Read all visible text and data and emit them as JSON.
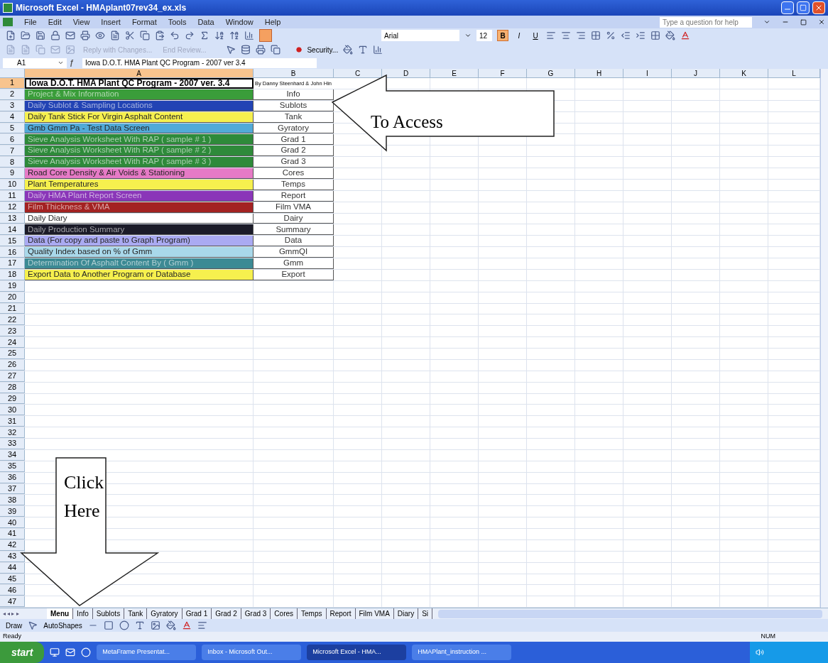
{
  "window": {
    "title": "Microsoft Excel - HMAplant07rev34_ex.xls"
  },
  "menu": [
    "File",
    "Edit",
    "View",
    "Insert",
    "Format",
    "Tools",
    "Data",
    "Window",
    "Help"
  ],
  "help_field": {
    "placeholder": "Type a question for help"
  },
  "formatting": {
    "font": "Arial",
    "size": "12",
    "styles": [
      {
        "label": "B",
        "on": true
      },
      {
        "label": "I",
        "on": false
      },
      {
        "label": "U",
        "on": false
      }
    ]
  },
  "review_toolbar": [
    {
      "label": "Reply with Changes...",
      "disabled": true
    },
    {
      "label": "End Review...",
      "disabled": true
    }
  ],
  "security_button": "Security...",
  "formula_bar": {
    "cell": "A1",
    "function_symbol": "ƒ",
    "formula": "Iowa D.O.T. HMA Plant QC Program - 2007 ver  3.4"
  },
  "columns": [
    {
      "label": "A",
      "selected": true
    },
    {
      "label": "B",
      "selected": false
    },
    {
      "label": "C",
      "selected": false
    },
    {
      "label": "D",
      "selected": false
    },
    {
      "label": "E",
      "selected": false
    },
    {
      "label": "F",
      "selected": false
    },
    {
      "label": "G",
      "selected": false
    },
    {
      "label": "H",
      "selected": false
    },
    {
      "label": "I",
      "selected": false
    },
    {
      "label": "J",
      "selected": false
    },
    {
      "label": "K",
      "selected": false
    },
    {
      "label": "L",
      "selected": false
    }
  ],
  "title_row": {
    "a": "Iowa D.O.T. HMA Plant QC Program - 2007 ver. 3.4",
    "b": "By Danny Steenhard & John Hin"
  },
  "menu_rows": [
    {
      "a": "Project & Mix Information",
      "b": "Info",
      "color": "#3a9d3a"
    },
    {
      "a": "Daily Sublot & Sampling Locations",
      "b": "Sublots",
      "color": "#2243b4"
    },
    {
      "a": "Daily Tank Stick For Virgin Asphalt Content",
      "b": "Tank",
      "color": "#f6f04e"
    },
    {
      "a": "Gmb Gmm Pa - Test Data Screen",
      "b": "Gyratory",
      "color": "#52aad8"
    },
    {
      "a": "Sieve Analysis Worksheet With RAP  ( sample # 1 )",
      "b": "Grad 1",
      "color": "#2e8a3a"
    },
    {
      "a": "Sieve Analysis Worksheet With RAP  ( sample # 2 )",
      "b": "Grad 2",
      "color": "#2e8a3a"
    },
    {
      "a": "Sieve Analysis Worksheet With RAP  ( sample # 3 )",
      "b": "Grad 3",
      "color": "#2e8a3a"
    },
    {
      "a": "Road  Core  Density & Air Voids & Stationing",
      "b": "Cores",
      "color": "#e67ac6"
    },
    {
      "a": "Plant  Temperatures",
      "b": "Temps",
      "color": "#f6f04e"
    },
    {
      "a": "Daily HMA Plant Report Screen",
      "b": "Report",
      "color": "#8a36b8"
    },
    {
      "a": "Film Thickness  &  VMA",
      "b": "Film  VMA",
      "color": "#a32222"
    },
    {
      "a": "Daily Diary",
      "b": "Dairy",
      "color": "#ffffff"
    },
    {
      "a": "Daily Production Summary",
      "b": "Summary",
      "color": "#1b1b28"
    },
    {
      "a": "Data (For copy and paste to Graph Program)",
      "b": "Data",
      "color": "#aaaaf2"
    },
    {
      "a": "Quality Index based on % of Gmm",
      "b": "GmmQI",
      "color": "#a9d8ea"
    },
    {
      "a": "Determination Of Asphalt Content By ( Gmm )",
      "b": "Gmm",
      "color": "#3c8a94"
    },
    {
      "a": "Export Data to Another Program or Database",
      "b": "Export",
      "color": "#f6f04e"
    }
  ],
  "row_numbers": [
    "1",
    "2",
    "3",
    "4",
    "5",
    "6",
    "7",
    "8",
    "9",
    "10",
    "11",
    "12",
    "13",
    "14",
    "15",
    "16",
    "17",
    "18",
    "19",
    "20",
    "21",
    "22",
    "23",
    "24",
    "25",
    "26",
    "27",
    "28",
    "29",
    "30",
    "31",
    "32",
    "33",
    "34",
    "35",
    "36",
    "37",
    "38",
    "39",
    "40",
    "41",
    "42",
    "43",
    "44",
    "45",
    "46",
    "47"
  ],
  "callouts": [
    {
      "text": "To Access"
    },
    {
      "text": "Click Here"
    }
  ],
  "tab_scroll_buttons": "◂ ◂ ▸ ▸",
  "sheet_tabs": [
    {
      "label": "Menu",
      "selected": true
    },
    {
      "label": "Info",
      "selected": false
    },
    {
      "label": "Sublots",
      "selected": false
    },
    {
      "label": "Tank",
      "selected": false
    },
    {
      "label": "Gyratory",
      "selected": false
    },
    {
      "label": "Grad 1",
      "selected": false
    },
    {
      "label": "Grad 2",
      "selected": false
    },
    {
      "label": "Grad 3",
      "selected": false
    },
    {
      "label": "Cores",
      "selected": false
    },
    {
      "label": "Temps",
      "selected": false
    },
    {
      "label": "Report",
      "selected": false
    },
    {
      "label": "Film  VMA",
      "selected": false
    },
    {
      "label": "Diary",
      "selected": false
    },
    {
      "label": "Si",
      "selected": false
    }
  ],
  "drawing_toolbar": [
    "Draw",
    "AutoShapes"
  ],
  "status_bar": {
    "status": "Ready",
    "indicator": "NUM"
  },
  "taskbar": {
    "start": "start",
    "items": [
      {
        "label": "MetaFrame Presentat...",
        "selected": false
      },
      {
        "label": "Inbox - Microsoft Out...",
        "selected": false
      },
      {
        "label": "Microsoft Excel - HMA...",
        "selected": true
      },
      {
        "label": "HMAPlant_instruction ...",
        "selected": false
      }
    ]
  }
}
